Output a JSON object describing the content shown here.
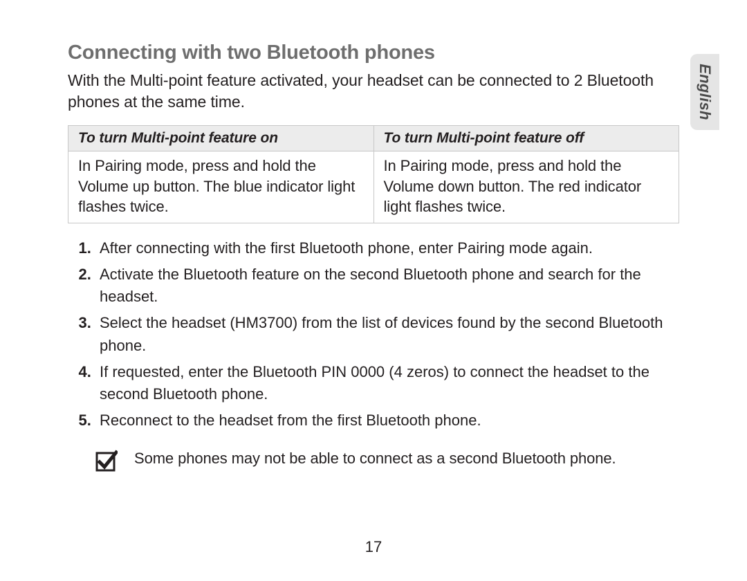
{
  "language_tab": "English",
  "section": {
    "title": "Connecting with two Bluetooth phones",
    "intro": "With the Multi-point feature activated, your headset can be connected to 2 Bluetooth phones at the same time."
  },
  "feature_table": {
    "on_header": "To turn Multi-point feature on",
    "on_body": "In Pairing mode, press and hold the Volume up button. The blue indicator light flashes twice.",
    "off_header": "To turn Multi-point feature off",
    "off_body": "In Pairing mode, press and hold the Volume down button. The red indicator light flashes twice."
  },
  "steps": {
    "s1": "After connecting with the first Bluetooth phone, enter Pairing mode again.",
    "s2": "Activate the Bluetooth feature on the second Bluetooth phone and search for the headset.",
    "s3": "Select the headset (HM3700) from the list of devices found by the second Bluetooth phone.",
    "s4": "If requested, enter the Bluetooth PIN 0000 (4 zeros) to connect the headset to the second Bluetooth phone.",
    "s5": "Reconnect to the headset from the first Bluetooth phone."
  },
  "note": "Some phones may not be able to connect as a second Bluetooth phone.",
  "page_number": "17"
}
